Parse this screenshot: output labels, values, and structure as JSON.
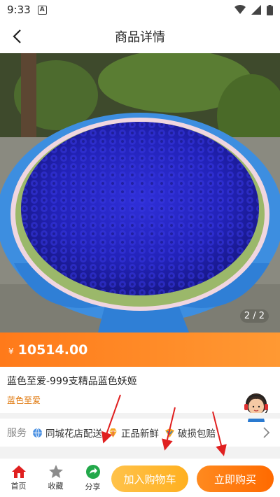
{
  "status_bar": {
    "time": "9:33",
    "notification_letter": "A"
  },
  "header": {
    "title": "商品详情",
    "back_icon": "chevron-left-icon"
  },
  "gallery": {
    "counter": "2 / 2"
  },
  "price": {
    "currency": "¥",
    "value": "10514.00"
  },
  "product": {
    "name": "蓝色至爱-999支精品蓝色妖姬",
    "tag": "蓝色至爱"
  },
  "services": {
    "label": "服务",
    "items": [
      {
        "label": "同城花店配送",
        "icon": "globe-icon"
      },
      {
        "label": "正品新鲜",
        "icon": "diamond-icon"
      },
      {
        "label": "破损包赔",
        "icon": "badge-icon"
      }
    ]
  },
  "bottom_nav": {
    "home": "首页",
    "favorite": "收藏",
    "share": "分享",
    "add_to_cart": "加入购物车",
    "buy_now": "立即购买"
  },
  "colors": {
    "accent": "#ff7a1a",
    "cart": "#ffb020",
    "buy": "#ff6a00",
    "annotation": "#e02020"
  }
}
